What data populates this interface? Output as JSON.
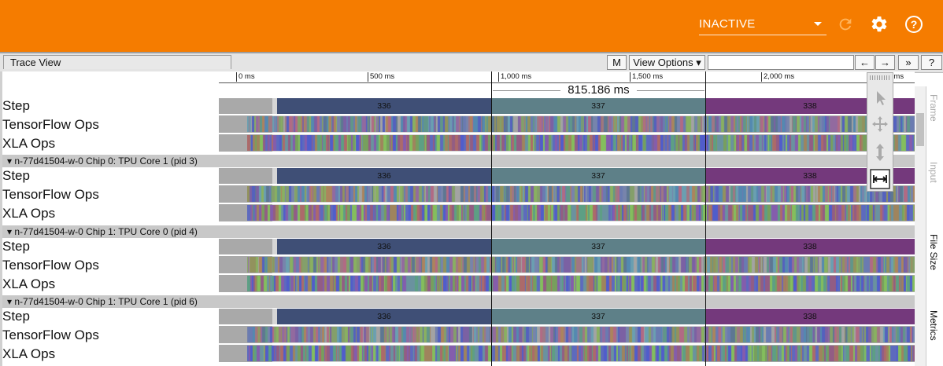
{
  "header": {
    "mode_select": "INACTIVE",
    "colors": {
      "bar": "#f57c00"
    },
    "icons": [
      "refresh-icon",
      "gear-icon",
      "help-icon"
    ]
  },
  "toolbar": {
    "title": "Trace View",
    "m_label": "M",
    "view_options_label": "View Options ▾",
    "search_value": "",
    "prev_label": "←",
    "next_label": "→",
    "more_label": "»",
    "help_label": "?"
  },
  "ruler": {
    "ticks": [
      "0 ms",
      "500 ms",
      "1,000 ms",
      "1,500 ms",
      "2,000 ms",
      "2,500 ms"
    ]
  },
  "selection": {
    "duration_label": "815.186 ms"
  },
  "top_rows": {
    "step": "Step",
    "tf_ops": "TensorFlow Ops",
    "xla_ops": "XLA Ops"
  },
  "processes": [
    {
      "header": "▾ n-77d41504-w-0 Chip 0: TPU Core 1 (pid 3)",
      "step": "Step",
      "tf_ops": "TensorFlow Ops",
      "xla_ops": "XLA Ops"
    },
    {
      "header": "▾ n-77d41504-w-0 Chip 1: TPU Core 0 (pid 4)",
      "step": "Step",
      "tf_ops": "TensorFlow Ops",
      "xla_ops": "XLA Ops"
    },
    {
      "header": "▾ n-77d41504-w-0 Chip 1: TPU Core 1 (pid 6)",
      "step": "Step",
      "tf_ops": "TensorFlow Ops",
      "xla_ops": "XLA Ops"
    }
  ],
  "steps": [
    "336",
    "337",
    "338"
  ],
  "step_colors": [
    "#3f4f76",
    "#5e8088",
    "#74397c"
  ],
  "side_tabs": [
    "Frame",
    "Input",
    "File Size",
    "Metrics"
  ],
  "tools": [
    "select-tool-icon",
    "pan-tool-icon",
    "zoom-tool-icon",
    "timing-tool-icon"
  ]
}
